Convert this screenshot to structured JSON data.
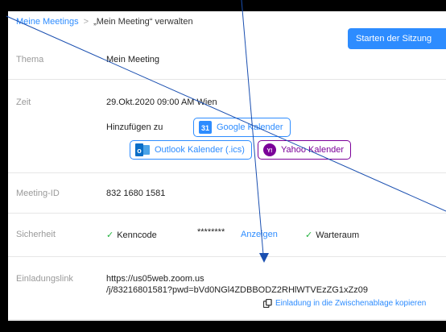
{
  "breadcrumb": {
    "parent": "Meine Meetings",
    "separator": ">",
    "current": "„Mein Meeting“ verwalten"
  },
  "header": {
    "start_button": "Starten der Sitzung"
  },
  "topic": {
    "label": "Thema",
    "value": "Mein Meeting"
  },
  "time": {
    "label": "Zeit",
    "value": "29.Okt.2020 09:00 AM Wien",
    "add_to": "Hinzufügen zu",
    "google_calendar": "Google Kalender",
    "google_icon_text": "31",
    "outlook_calendar": "Outlook Kalender (.ics)",
    "outlook_icon_text": "o",
    "yahoo_calendar": "Yahoo Kalender",
    "yahoo_icon_text": "Y!"
  },
  "meeting_id": {
    "label": "Meeting-ID",
    "value": "832 1680 1581"
  },
  "security": {
    "label": "Sicherheit",
    "passcode_label": "Kenncode",
    "passcode_mask": "********",
    "show_link": "Anzeigen",
    "waiting_room": "Warteraum"
  },
  "invite": {
    "label": "Einladungslink",
    "url_line1": "https://us05web.zoom.us",
    "url_line2": "/j/83216801581?pwd=bVd0NGl4ZDBBODZ2RHlWTVEzZG1xZz09",
    "copy_label": "Einladung in die Zwischenablage kopieren"
  },
  "colors": {
    "accent": "#2d8cff",
    "yahoo": "#7b0099",
    "check": "#23b33e",
    "annotation_line": "#1a4fb0"
  }
}
